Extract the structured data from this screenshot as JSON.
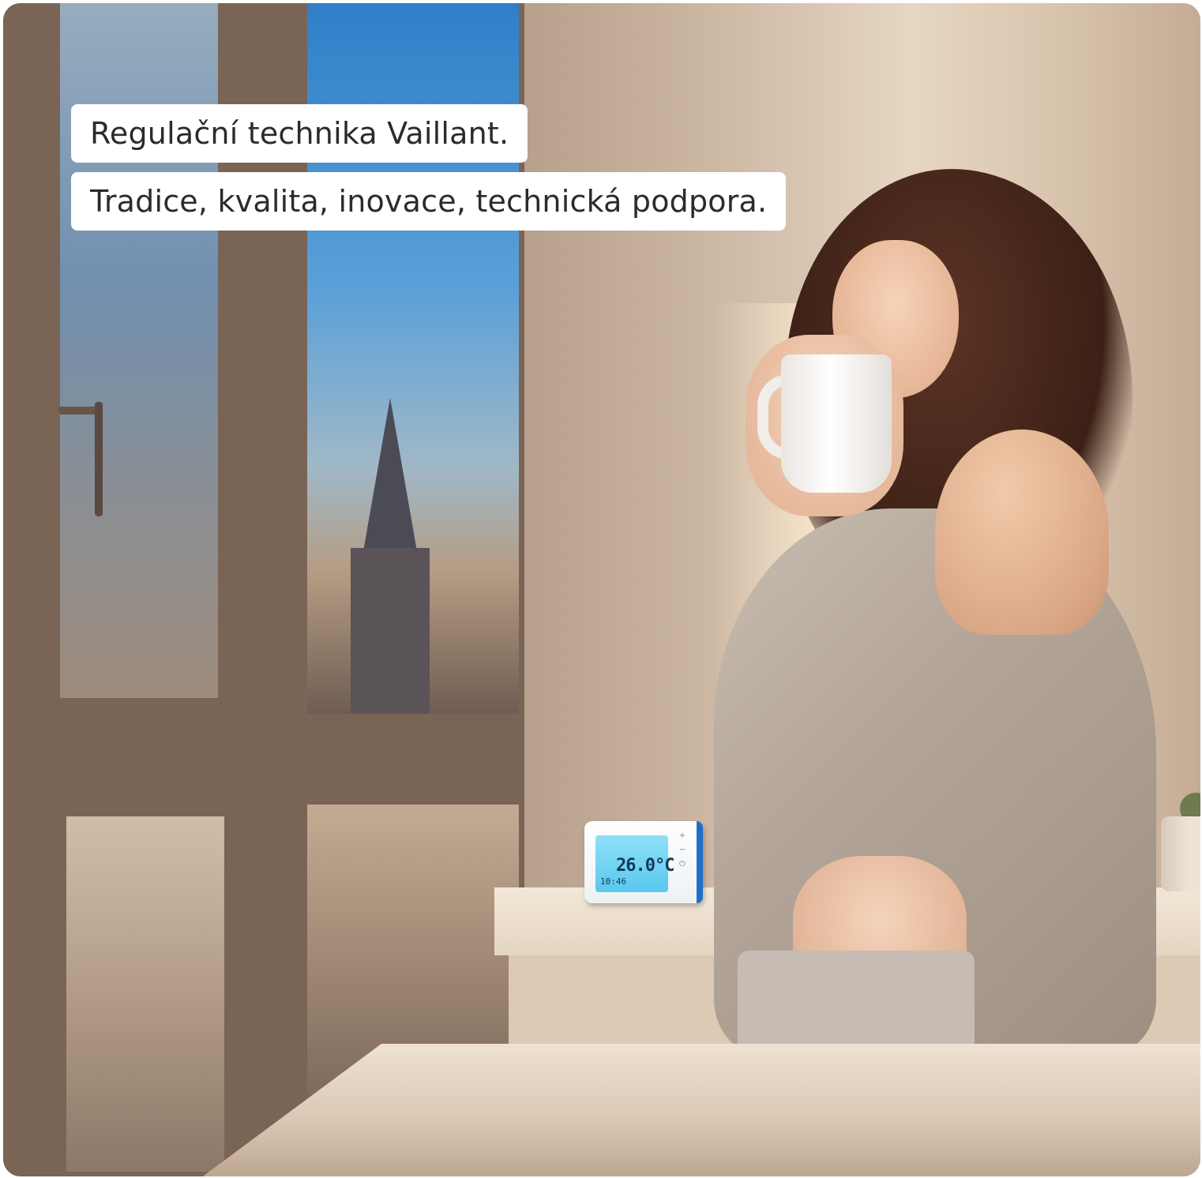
{
  "captions": {
    "line1": "Regulační technika Vaillant.",
    "line2": "Tradice, kvalita, inovace, technická podpora."
  },
  "thermostat": {
    "temperature": "26.0°C",
    "time": "10:46"
  },
  "colors": {
    "caption_background": "#ffffff",
    "caption_text": "#2b2b2b",
    "thermostat_accent": "#1f6fc9",
    "thermostat_screen": "#59c8ee"
  }
}
